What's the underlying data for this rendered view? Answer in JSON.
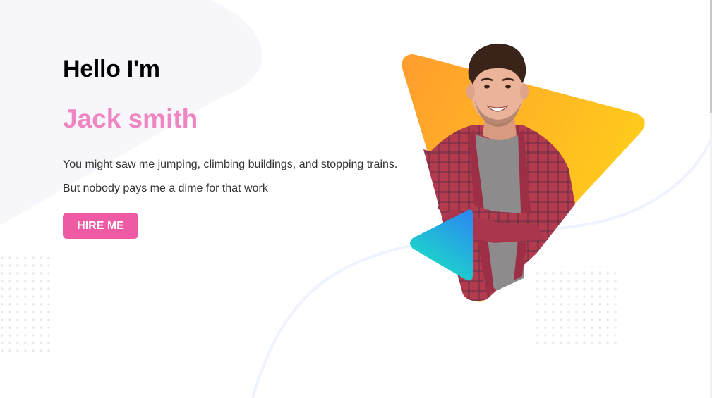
{
  "hero": {
    "greeting": "Hello I'm",
    "name": "Jack smith",
    "description_line1": "You might saw me jumping, climbing buildings, and stopping trains.",
    "description_line2": "But nobody pays me a dime for that work",
    "cta_label": "HIRE ME"
  },
  "colors": {
    "accent_pink": "#ee5aa4",
    "name_pink": "#ef86c3",
    "triangle_orange": "#ff9c2e",
    "triangle_yellow": "#ffd01a",
    "play_teal": "#19e6c1",
    "play_blue": "#2b8cf0",
    "shirt_red": "#b43a4e",
    "tshirt_grey": "#8e8b8c",
    "hair_brown": "#3a2419",
    "skin": "#eab39a"
  },
  "icons": {
    "play": "play-triangle-icon"
  }
}
